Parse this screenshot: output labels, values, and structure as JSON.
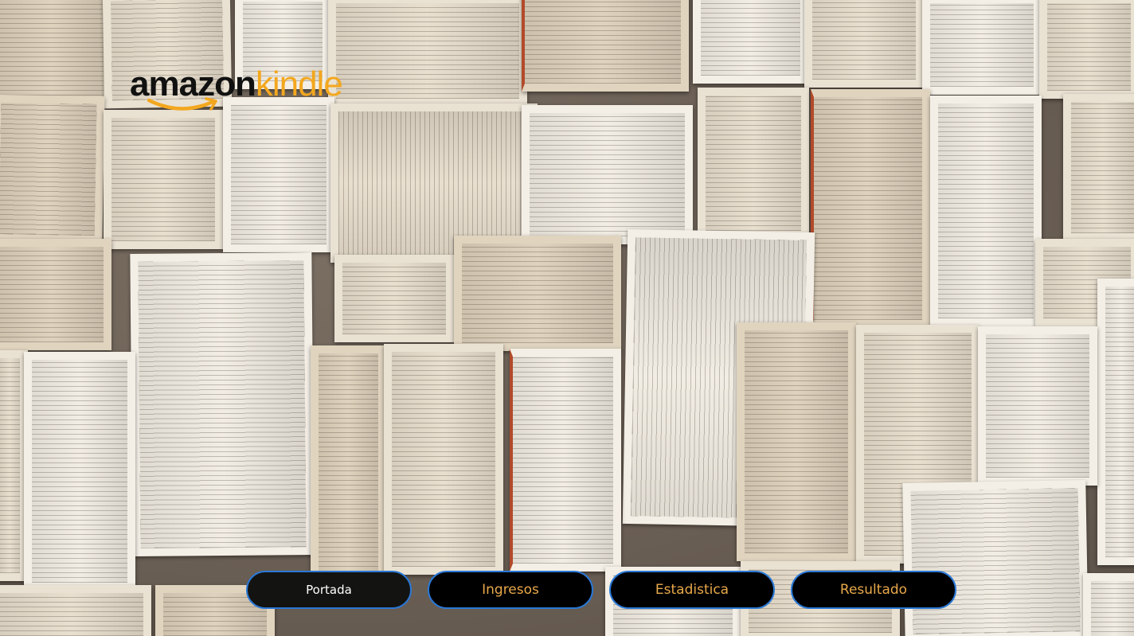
{
  "logo": {
    "brand": "amazon",
    "product": "kindle"
  },
  "nav": {
    "buttons": [
      {
        "label": "Portada"
      },
      {
        "label": "Ingresos"
      },
      {
        "label": "Estadistica"
      },
      {
        "label": "Resultado"
      }
    ],
    "active_index": 0
  },
  "colors": {
    "button_border": "#2a78d6",
    "button_bg": "#000000",
    "button_text": "#e8a84a",
    "active_text": "#ffffff",
    "kindle_orange": "#f3a71e"
  }
}
